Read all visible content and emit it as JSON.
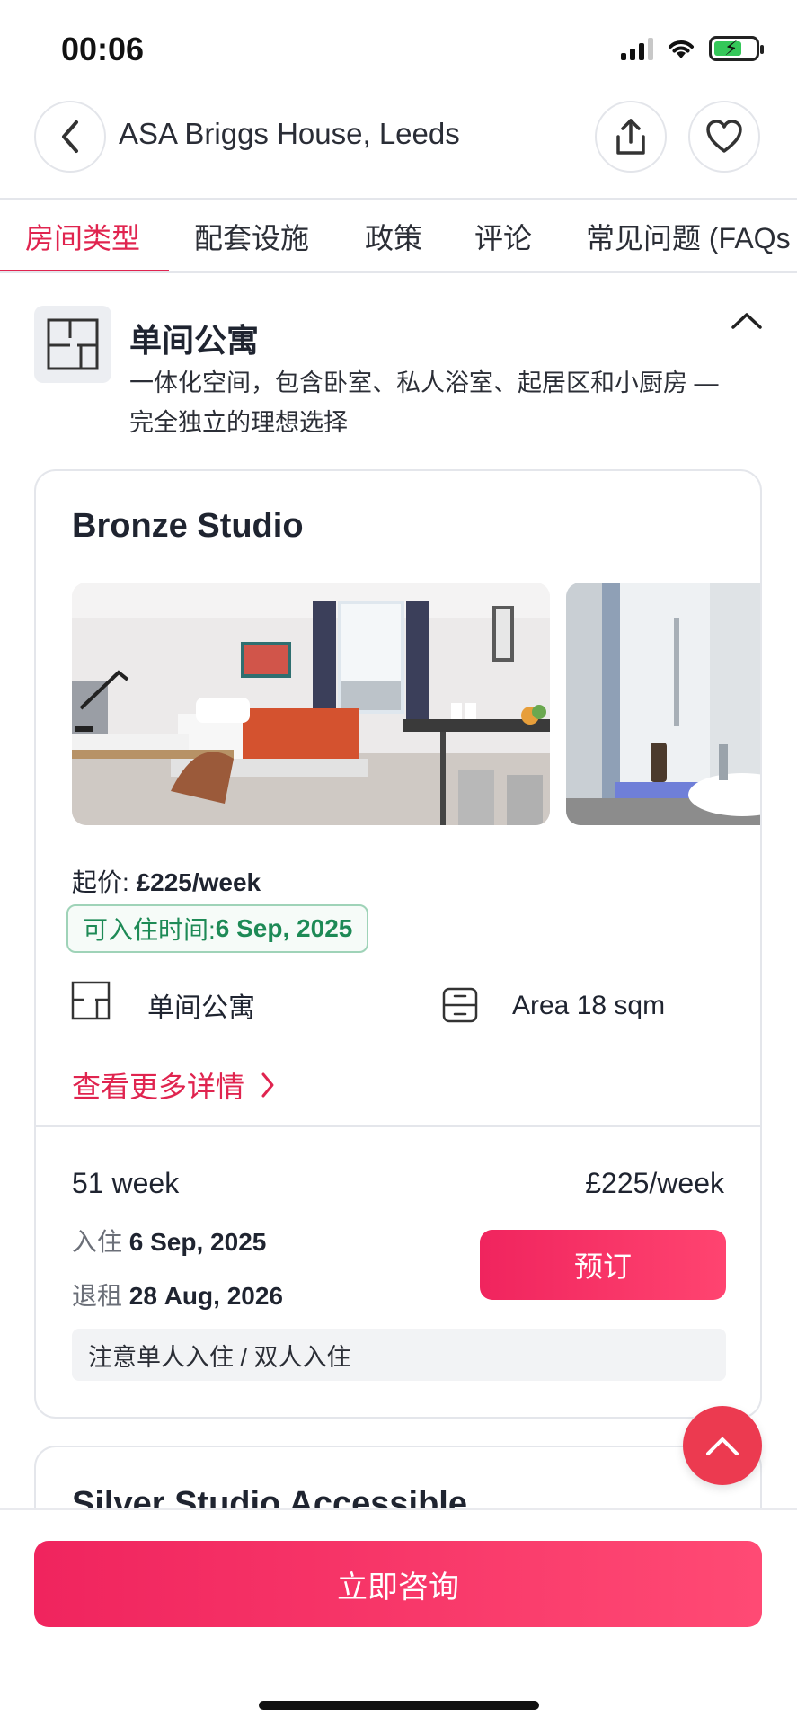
{
  "status_bar": {
    "time": "00:06"
  },
  "header": {
    "title": "ASA Briggs House, Leeds",
    "back_icon": "chevron-left-icon",
    "share_icon": "share-icon",
    "favorite_icon": "heart-icon"
  },
  "tabs": [
    {
      "label": "房间类型",
      "active": true
    },
    {
      "label": "配套设施",
      "active": false
    },
    {
      "label": "政策",
      "active": false
    },
    {
      "label": "评论",
      "active": false
    },
    {
      "label": "常见问题 (FAQs",
      "active": false
    }
  ],
  "room_type": {
    "title": "单间公寓",
    "description": "一体化空间，包含卧室、私人浴室、起居区和小厨房 — 完全独立的理想选择"
  },
  "listing": {
    "title": "Bronze Studio",
    "price_from_label": "起价: ",
    "price_from_value": "£225/week",
    "availability_label": "可入住时间: ",
    "availability_value": "6 Sep, 2025",
    "features": {
      "type_label": "单间公寓",
      "area_label": "Area 18 sqm"
    },
    "more_details": "查看更多详情",
    "option": {
      "duration": "51 week",
      "price": "£225/week",
      "move_in_label": "入住 ",
      "move_in_date": "6 Sep, 2025",
      "move_out_label": "退租 ",
      "move_out_date": "28 Aug, 2026",
      "book_label": "预订",
      "notice": "注意单人入住 / 双人入住"
    }
  },
  "next_listing": {
    "title": "Silver Studio Accessible"
  },
  "bottom": {
    "consult_label": "立即咨询"
  },
  "colors": {
    "accent": "#e0244f",
    "available_green": "#1e8a56"
  }
}
